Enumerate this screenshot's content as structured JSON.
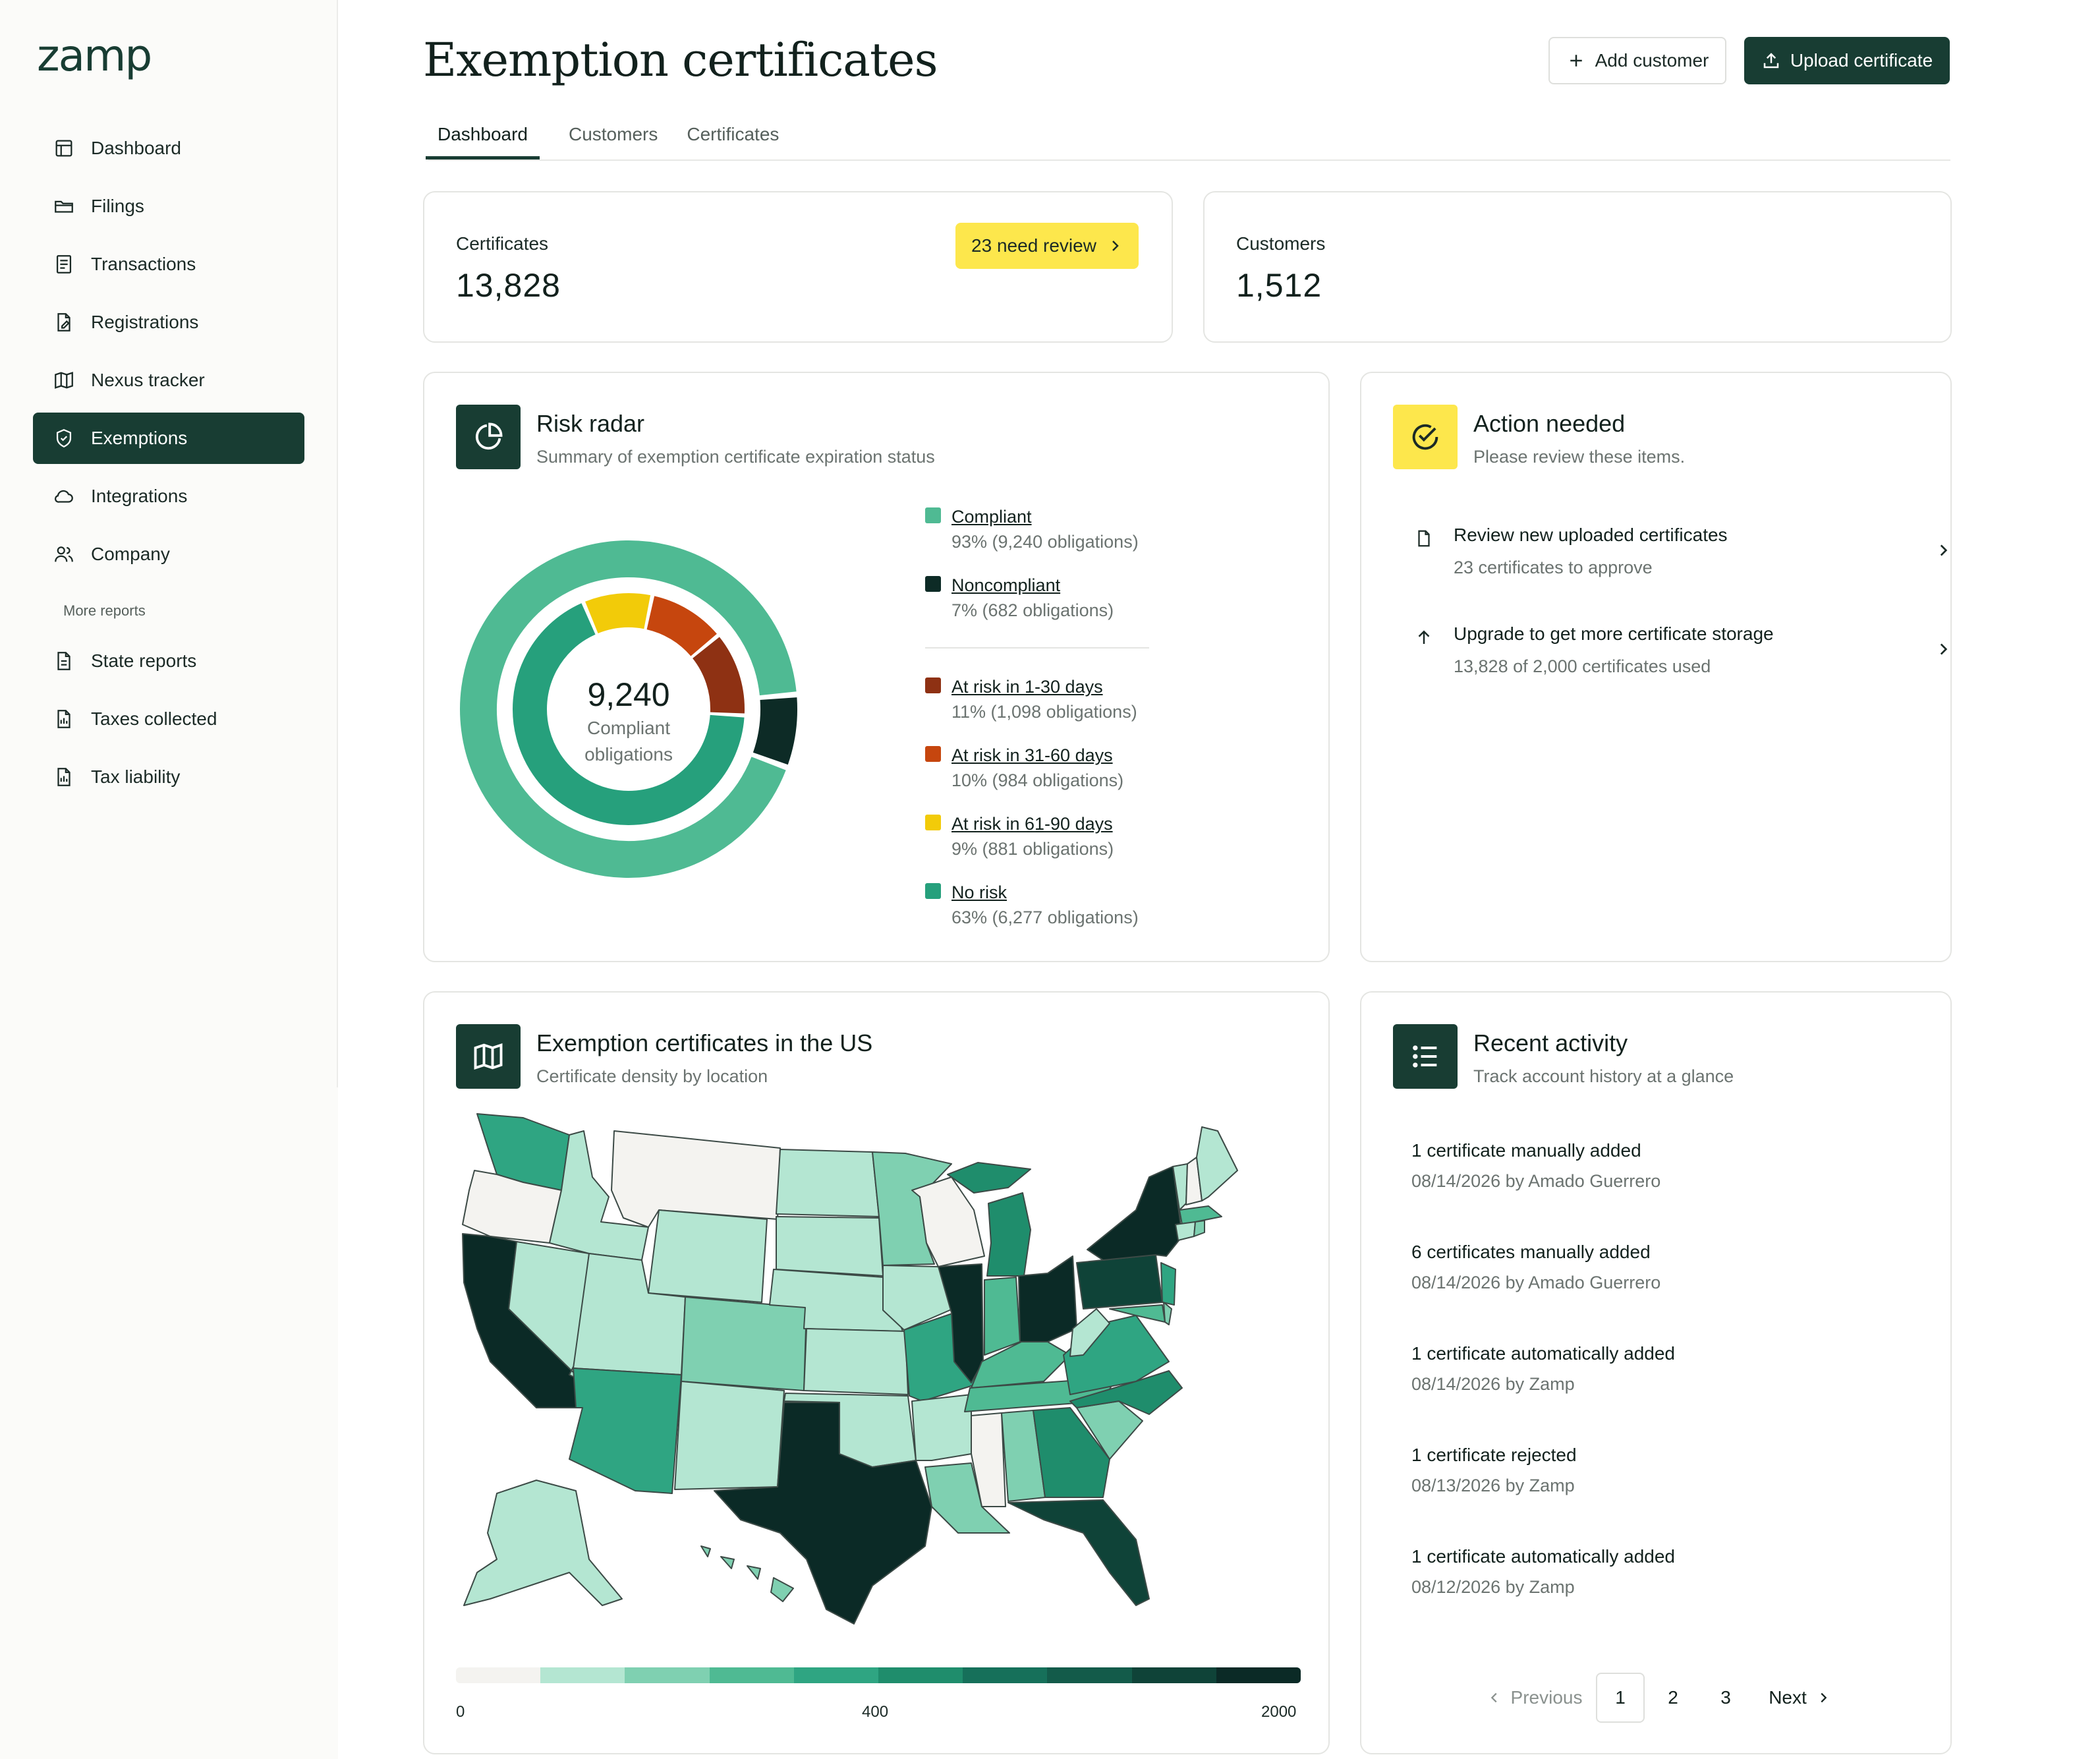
{
  "app": {
    "logo": "zamp"
  },
  "sidebar": {
    "items": [
      {
        "label": "Dashboard",
        "icon": "dashboard-icon"
      },
      {
        "label": "Filings",
        "icon": "folder-icon"
      },
      {
        "label": "Transactions",
        "icon": "receipt-icon"
      },
      {
        "label": "Registrations",
        "icon": "file-edit-icon"
      },
      {
        "label": "Nexus tracker",
        "icon": "map-icon"
      },
      {
        "label": "Exemptions",
        "icon": "shield-check-icon",
        "active": true
      },
      {
        "label": "Integrations",
        "icon": "cloud-icon"
      },
      {
        "label": "Company",
        "icon": "users-icon"
      }
    ],
    "section_label": "More reports",
    "reports": [
      {
        "label": "State reports",
        "icon": "report-icon"
      },
      {
        "label": "Taxes collected",
        "icon": "report-chart-icon"
      },
      {
        "label": "Tax liability",
        "icon": "report-chart-icon"
      }
    ]
  },
  "header": {
    "title": "Exemption certificates",
    "add_customer": "Add customer",
    "upload_certificate": "Upload certificate"
  },
  "tabs": [
    "Dashboard",
    "Customers",
    "Certificates"
  ],
  "stats": {
    "certificates_label": "Certificates",
    "certificates_value": "13,828",
    "review_badge": "23 need review",
    "customers_label": "Customers",
    "customers_value": "1,512"
  },
  "risk_radar": {
    "title": "Risk radar",
    "subtitle": "Summary of exemption certificate expiration status",
    "center_value": "9,240",
    "center_line1": "Compliant",
    "center_line2": "obligations",
    "outer": [
      {
        "name": "Compliant",
        "value": "93% (9,240 obligations)",
        "pct": 93,
        "color": "#4fba93"
      },
      {
        "name": "Noncompliant",
        "value": "7% (682 obligations)",
        "pct": 7,
        "color": "#0d2b26"
      }
    ],
    "inner": [
      {
        "name": "At risk in 1-30 days",
        "value": "11% (1,098 obligations)",
        "pct": 11,
        "color": "#8e3113"
      },
      {
        "name": "At risk in 31-60 days",
        "value": "10% (984 obligations)",
        "pct": 10,
        "color": "#c6460e"
      },
      {
        "name": "At risk in 61-90 days",
        "value": "9% (881 obligations)",
        "pct": 9,
        "color": "#f2cb09"
      },
      {
        "name": "No risk",
        "value": "63% (6,277 obligations)",
        "pct": 63,
        "color": "#26a07c"
      }
    ]
  },
  "action_needed": {
    "title": "Action needed",
    "subtitle": "Please review these items.",
    "items": [
      {
        "title": "Review new uploaded certificates",
        "sub": "23 certificates to approve",
        "icon": "document-icon"
      },
      {
        "title": "Upgrade to get more certificate storage",
        "sub": "13,828 of 2,000 certificates used",
        "icon": "arrow-up-icon"
      }
    ]
  },
  "map_card": {
    "title": "Exemption certificates in the US",
    "subtitle": "Certificate density by location",
    "scale_min": "0",
    "scale_mid": "400",
    "scale_max": "2000",
    "scale_colors": [
      "#f4f3f0",
      "#b4e6d2",
      "#7fd0b1",
      "#4fba93",
      "#2fa582",
      "#1f8d6c",
      "#16705a",
      "#135b4a",
      "#0f4338",
      "#0b2a26"
    ]
  },
  "recent_activity": {
    "title": "Recent activity",
    "subtitle": "Track account history at a glance",
    "items": [
      {
        "title": "1 certificate manually added",
        "sub": "08/14/2026 by Amado Guerrero"
      },
      {
        "title": "6 certificates manually added",
        "sub": "08/14/2026 by Amado Guerrero"
      },
      {
        "title": "1 certificate automatically added",
        "sub": "08/14/2026 by Zamp"
      },
      {
        "title": "1 certificate rejected",
        "sub": "08/13/2026 by Zamp"
      },
      {
        "title": "1 certificate automatically added",
        "sub": "08/12/2026 by Zamp"
      }
    ],
    "pager": {
      "previous": "Previous",
      "pages": [
        "1",
        "2",
        "3"
      ],
      "current": "1",
      "next": "Next"
    }
  }
}
